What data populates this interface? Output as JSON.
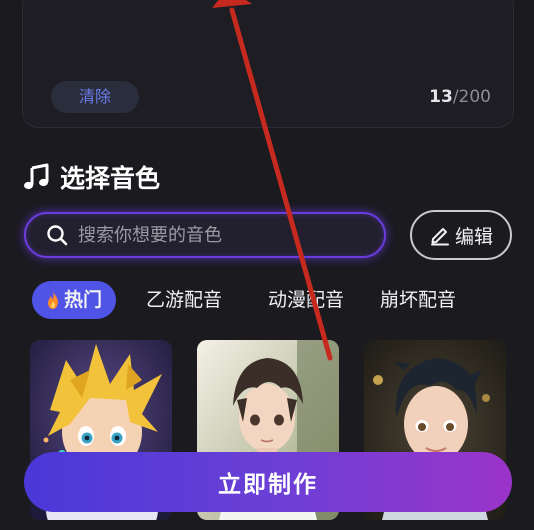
{
  "text_panel": {
    "clear_label": "清除",
    "count_current": "13",
    "count_separator": "/",
    "count_max": "200"
  },
  "section": {
    "title": "选择音色",
    "icon": "music-note-icon"
  },
  "search": {
    "placeholder": "搜索你想要的音色",
    "icon": "search-icon"
  },
  "edit": {
    "label": "编辑",
    "icon": "pencil-icon"
  },
  "tabs": [
    {
      "label": "热门",
      "icon": "fire-icon",
      "active": true
    },
    {
      "label": "乙游配音",
      "active": false
    },
    {
      "label": "动漫配音",
      "active": false
    },
    {
      "label": "崩坏配音",
      "active": false
    }
  ],
  "voices": [
    {
      "image": "anime-blonde-boy-avatar"
    },
    {
      "image": "anime-brown-hair-boy-avatar"
    },
    {
      "image": "anime-dark-hair-boy-avatar"
    }
  ],
  "primary_action": {
    "label": "立即制作"
  },
  "colors": {
    "background": "#1a1a1f",
    "accent": "#4f54e6",
    "search_glow": "#6a3cdc",
    "clear_text": "#6a7bea",
    "gradient_start": "#4a38d8",
    "gradient_end": "#9b34c9",
    "annotation_arrow": "#c62a1f"
  }
}
